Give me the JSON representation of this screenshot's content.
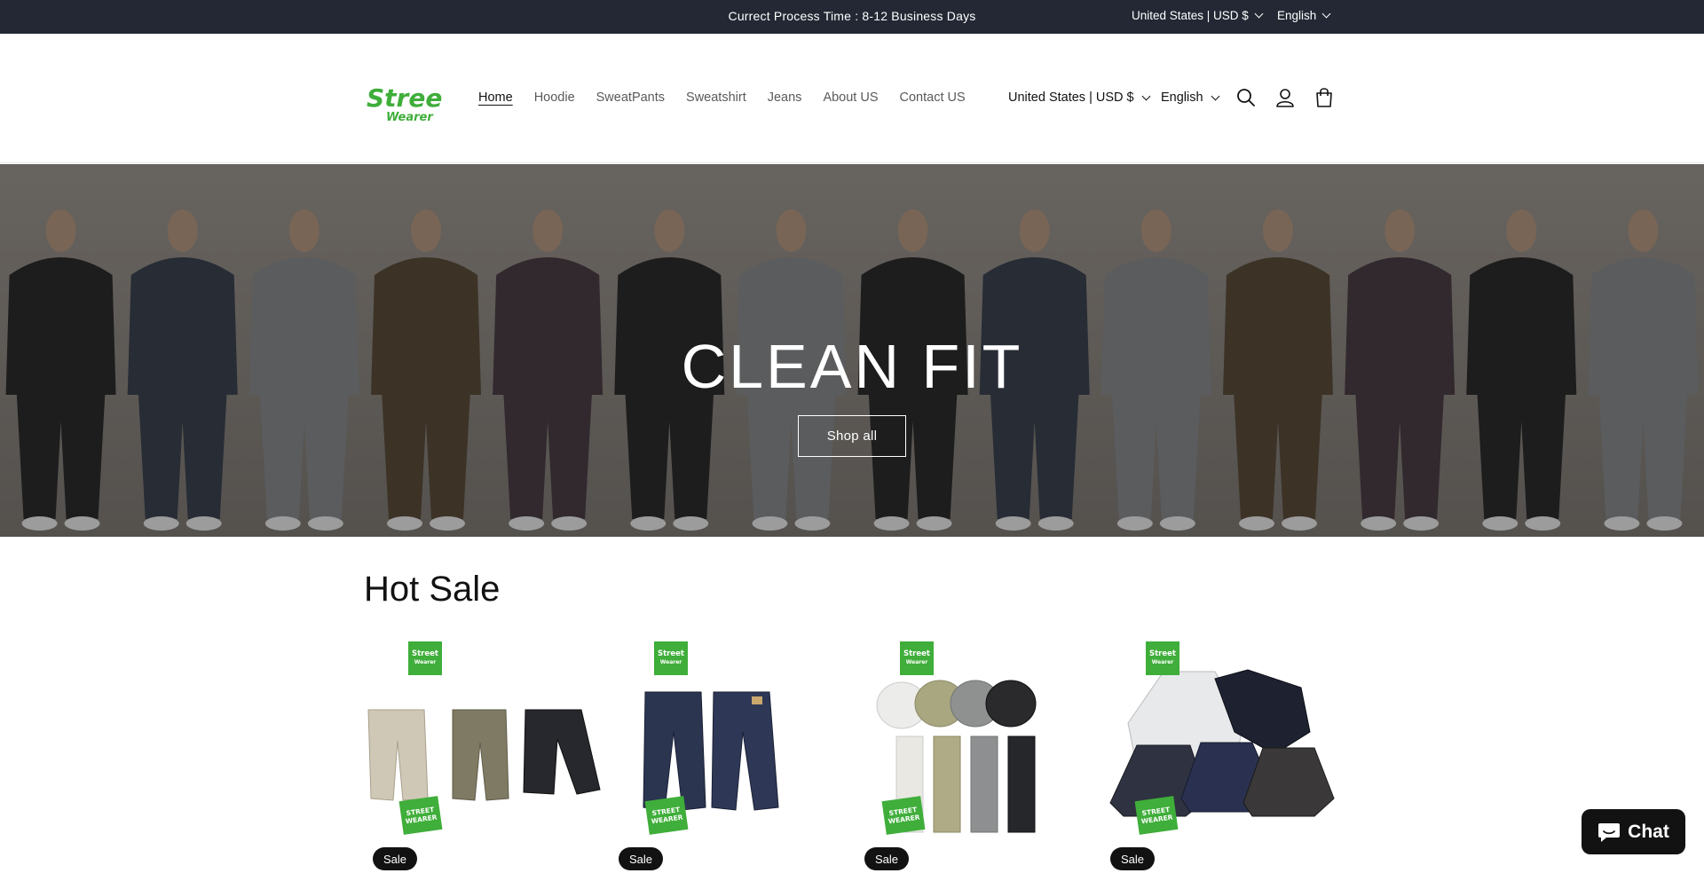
{
  "announcement": {
    "text": "Currect Process Time : 8-12 Business Days",
    "country": "United States | USD $",
    "language": "English"
  },
  "header": {
    "logo": {
      "line1": "Street",
      "line2": "Wearer",
      "color": "#3fae3a"
    },
    "nav": [
      {
        "label": "Home",
        "active": true
      },
      {
        "label": "Hoodie"
      },
      {
        "label": "SweatPants"
      },
      {
        "label": "Sweatshirt"
      },
      {
        "label": "Jeans"
      },
      {
        "label": "About US"
      },
      {
        "label": "Contact US"
      }
    ],
    "country": "United States | USD $",
    "language": "English",
    "icons": [
      "search-icon",
      "account-icon",
      "cart-icon"
    ]
  },
  "hero": {
    "title": "CLEAN FIT",
    "button_label": "Shop all"
  },
  "hot_sale": {
    "title": "Hot Sale",
    "products": [
      {
        "badge": "Sale",
        "tag_top": [
          "Street",
          "Wearer"
        ],
        "tag_bag": [
          "STREET",
          "WEARER"
        ],
        "image": "cargo-shorts"
      },
      {
        "badge": "Sale",
        "tag_top": [
          "Street",
          "Wearer"
        ],
        "tag_bag": [
          "STREET",
          "WEARER"
        ],
        "image": "barrel-jeans"
      },
      {
        "badge": "Sale",
        "tag_top": [
          "Street",
          "Wearer"
        ],
        "tag_bag": [
          "STREET",
          "WEARER"
        ],
        "image": "sweatshirt-pants-set"
      },
      {
        "badge": "Sale",
        "tag_top": [
          "Street",
          "Wearer"
        ],
        "tag_bag": [
          "STREET",
          "WEARER"
        ],
        "image": "zip-hoodies"
      }
    ]
  },
  "chat": {
    "label": "Chat"
  },
  "colors": {
    "announcement_bg": "#232834",
    "brand_green": "#3fae3a",
    "badge_bg": "#121212"
  }
}
